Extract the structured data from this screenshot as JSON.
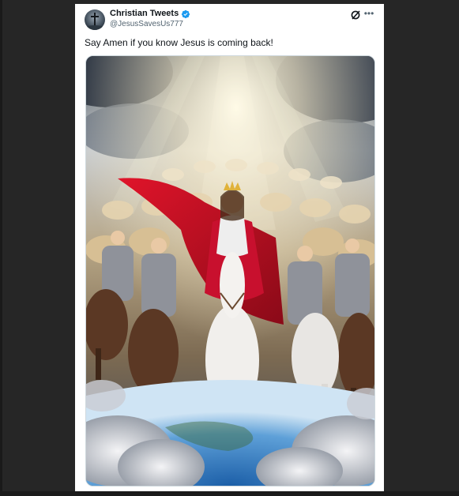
{
  "post": {
    "author": {
      "display_name": "Christian Tweets",
      "handle": "@JesusSavesUs777",
      "verified": true,
      "avatar_icon": "cross-avatar-icon"
    },
    "text": "Say Amen if you know Jesus is coming back!",
    "media": {
      "kind": "image",
      "subject": "christ-on-white-horse-with-angel-army"
    },
    "actions": {
      "grok_icon": "grok-icon",
      "more_icon": "more-dots-icon",
      "more_label": "•••"
    }
  },
  "colors": {
    "background": "#262626",
    "card": "#ffffff",
    "text_primary": "#0f1419",
    "text_secondary": "#536471",
    "verified_blue": "#1d9bf0",
    "robe_red": "#c8102e"
  }
}
